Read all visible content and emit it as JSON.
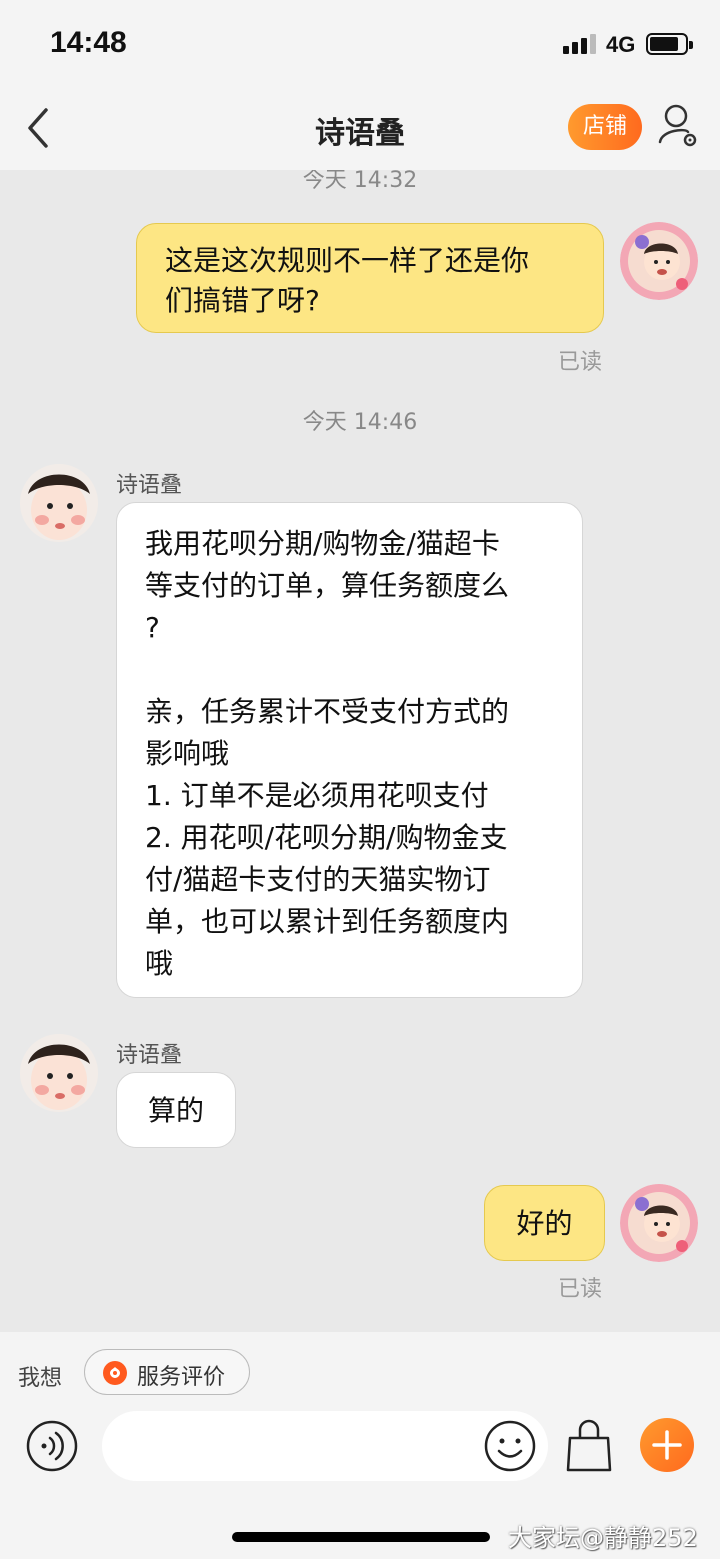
{
  "status_bar": {
    "time": "14:48",
    "network": "4G"
  },
  "header": {
    "title": "诗语叠",
    "shop_label": "店铺"
  },
  "chat": {
    "timestamp_1": "今天 14:32",
    "msg_out_1": {
      "lines": [
        "这是这次规则不一样了还是你",
        "们搞错了呀?"
      ],
      "read": "已读"
    },
    "timestamp_2": "今天 14:46",
    "msg_in_1": {
      "sender": "诗语叠",
      "lines": [
        "我用花呗分期/购物金/猫超卡",
        "等支付的订单，算任务额度么",
        "?",
        "",
        "亲，任务累计不受支付方式的",
        "影响哦",
        "1. 订单不是必须用花呗支付",
        "2. 用花呗/花呗分期/购物金支",
        "付/猫超卡支付的天猫实物订",
        "单，也可以累计到任务额度内",
        "哦"
      ]
    },
    "msg_in_2": {
      "sender": "诗语叠",
      "text": "算的"
    },
    "msg_out_2": {
      "text": "好的",
      "read": "已读"
    }
  },
  "bottom": {
    "quick_label": "我想",
    "service_rating": "服务评价",
    "input_placeholder": "",
    "watermark": "大家坛@静静252"
  },
  "colors": {
    "accent": "#ff7a22",
    "out_bubble": "#fde684"
  }
}
